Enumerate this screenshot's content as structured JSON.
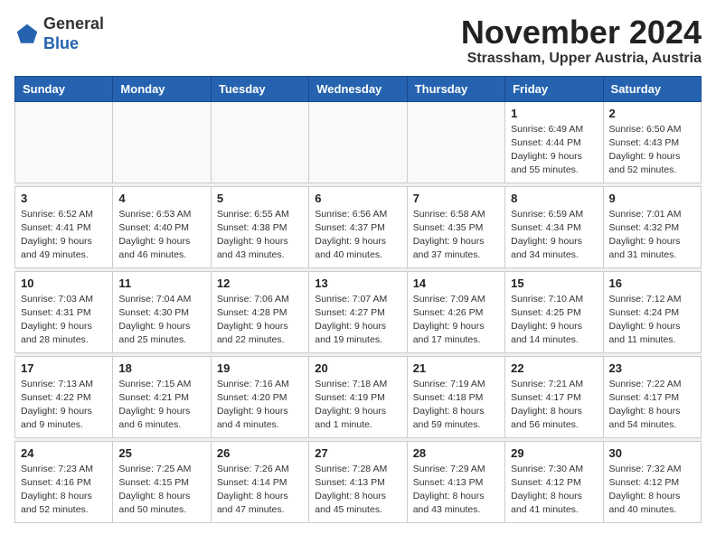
{
  "header": {
    "logo_general": "General",
    "logo_blue": "Blue",
    "month_year": "November 2024",
    "location": "Strassham, Upper Austria, Austria"
  },
  "weekdays": [
    "Sunday",
    "Monday",
    "Tuesday",
    "Wednesday",
    "Thursday",
    "Friday",
    "Saturday"
  ],
  "weeks": [
    [
      {
        "day": "",
        "info": ""
      },
      {
        "day": "",
        "info": ""
      },
      {
        "day": "",
        "info": ""
      },
      {
        "day": "",
        "info": ""
      },
      {
        "day": "",
        "info": ""
      },
      {
        "day": "1",
        "info": "Sunrise: 6:49 AM\nSunset: 4:44 PM\nDaylight: 9 hours\nand 55 minutes."
      },
      {
        "day": "2",
        "info": "Sunrise: 6:50 AM\nSunset: 4:43 PM\nDaylight: 9 hours\nand 52 minutes."
      }
    ],
    [
      {
        "day": "3",
        "info": "Sunrise: 6:52 AM\nSunset: 4:41 PM\nDaylight: 9 hours\nand 49 minutes."
      },
      {
        "day": "4",
        "info": "Sunrise: 6:53 AM\nSunset: 4:40 PM\nDaylight: 9 hours\nand 46 minutes."
      },
      {
        "day": "5",
        "info": "Sunrise: 6:55 AM\nSunset: 4:38 PM\nDaylight: 9 hours\nand 43 minutes."
      },
      {
        "day": "6",
        "info": "Sunrise: 6:56 AM\nSunset: 4:37 PM\nDaylight: 9 hours\nand 40 minutes."
      },
      {
        "day": "7",
        "info": "Sunrise: 6:58 AM\nSunset: 4:35 PM\nDaylight: 9 hours\nand 37 minutes."
      },
      {
        "day": "8",
        "info": "Sunrise: 6:59 AM\nSunset: 4:34 PM\nDaylight: 9 hours\nand 34 minutes."
      },
      {
        "day": "9",
        "info": "Sunrise: 7:01 AM\nSunset: 4:32 PM\nDaylight: 9 hours\nand 31 minutes."
      }
    ],
    [
      {
        "day": "10",
        "info": "Sunrise: 7:03 AM\nSunset: 4:31 PM\nDaylight: 9 hours\nand 28 minutes."
      },
      {
        "day": "11",
        "info": "Sunrise: 7:04 AM\nSunset: 4:30 PM\nDaylight: 9 hours\nand 25 minutes."
      },
      {
        "day": "12",
        "info": "Sunrise: 7:06 AM\nSunset: 4:28 PM\nDaylight: 9 hours\nand 22 minutes."
      },
      {
        "day": "13",
        "info": "Sunrise: 7:07 AM\nSunset: 4:27 PM\nDaylight: 9 hours\nand 19 minutes."
      },
      {
        "day": "14",
        "info": "Sunrise: 7:09 AM\nSunset: 4:26 PM\nDaylight: 9 hours\nand 17 minutes."
      },
      {
        "day": "15",
        "info": "Sunrise: 7:10 AM\nSunset: 4:25 PM\nDaylight: 9 hours\nand 14 minutes."
      },
      {
        "day": "16",
        "info": "Sunrise: 7:12 AM\nSunset: 4:24 PM\nDaylight: 9 hours\nand 11 minutes."
      }
    ],
    [
      {
        "day": "17",
        "info": "Sunrise: 7:13 AM\nSunset: 4:22 PM\nDaylight: 9 hours\nand 9 minutes."
      },
      {
        "day": "18",
        "info": "Sunrise: 7:15 AM\nSunset: 4:21 PM\nDaylight: 9 hours\nand 6 minutes."
      },
      {
        "day": "19",
        "info": "Sunrise: 7:16 AM\nSunset: 4:20 PM\nDaylight: 9 hours\nand 4 minutes."
      },
      {
        "day": "20",
        "info": "Sunrise: 7:18 AM\nSunset: 4:19 PM\nDaylight: 9 hours\nand 1 minute."
      },
      {
        "day": "21",
        "info": "Sunrise: 7:19 AM\nSunset: 4:18 PM\nDaylight: 8 hours\nand 59 minutes."
      },
      {
        "day": "22",
        "info": "Sunrise: 7:21 AM\nSunset: 4:17 PM\nDaylight: 8 hours\nand 56 minutes."
      },
      {
        "day": "23",
        "info": "Sunrise: 7:22 AM\nSunset: 4:17 PM\nDaylight: 8 hours\nand 54 minutes."
      }
    ],
    [
      {
        "day": "24",
        "info": "Sunrise: 7:23 AM\nSunset: 4:16 PM\nDaylight: 8 hours\nand 52 minutes."
      },
      {
        "day": "25",
        "info": "Sunrise: 7:25 AM\nSunset: 4:15 PM\nDaylight: 8 hours\nand 50 minutes."
      },
      {
        "day": "26",
        "info": "Sunrise: 7:26 AM\nSunset: 4:14 PM\nDaylight: 8 hours\nand 47 minutes."
      },
      {
        "day": "27",
        "info": "Sunrise: 7:28 AM\nSunset: 4:13 PM\nDaylight: 8 hours\nand 45 minutes."
      },
      {
        "day": "28",
        "info": "Sunrise: 7:29 AM\nSunset: 4:13 PM\nDaylight: 8 hours\nand 43 minutes."
      },
      {
        "day": "29",
        "info": "Sunrise: 7:30 AM\nSunset: 4:12 PM\nDaylight: 8 hours\nand 41 minutes."
      },
      {
        "day": "30",
        "info": "Sunrise: 7:32 AM\nSunset: 4:12 PM\nDaylight: 8 hours\nand 40 minutes."
      }
    ]
  ]
}
